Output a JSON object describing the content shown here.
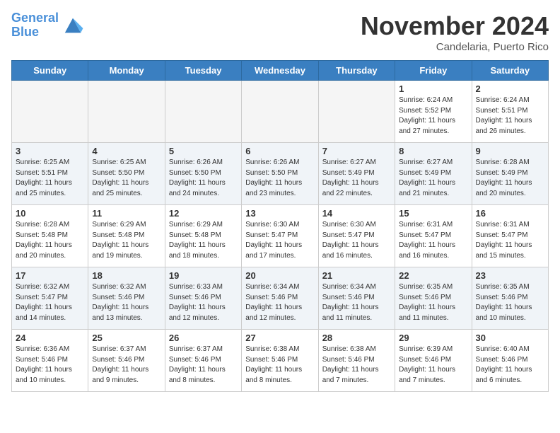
{
  "header": {
    "logo_line1": "General",
    "logo_line2": "Blue",
    "month": "November 2024",
    "location": "Candelaria, Puerto Rico"
  },
  "weekdays": [
    "Sunday",
    "Monday",
    "Tuesday",
    "Wednesday",
    "Thursday",
    "Friday",
    "Saturday"
  ],
  "weeks": [
    [
      {
        "day": "",
        "info": ""
      },
      {
        "day": "",
        "info": ""
      },
      {
        "day": "",
        "info": ""
      },
      {
        "day": "",
        "info": ""
      },
      {
        "day": "",
        "info": ""
      },
      {
        "day": "1",
        "info": "Sunrise: 6:24 AM\nSunset: 5:52 PM\nDaylight: 11 hours\nand 27 minutes."
      },
      {
        "day": "2",
        "info": "Sunrise: 6:24 AM\nSunset: 5:51 PM\nDaylight: 11 hours\nand 26 minutes."
      }
    ],
    [
      {
        "day": "3",
        "info": "Sunrise: 6:25 AM\nSunset: 5:51 PM\nDaylight: 11 hours\nand 25 minutes."
      },
      {
        "day": "4",
        "info": "Sunrise: 6:25 AM\nSunset: 5:50 PM\nDaylight: 11 hours\nand 25 minutes."
      },
      {
        "day": "5",
        "info": "Sunrise: 6:26 AM\nSunset: 5:50 PM\nDaylight: 11 hours\nand 24 minutes."
      },
      {
        "day": "6",
        "info": "Sunrise: 6:26 AM\nSunset: 5:50 PM\nDaylight: 11 hours\nand 23 minutes."
      },
      {
        "day": "7",
        "info": "Sunrise: 6:27 AM\nSunset: 5:49 PM\nDaylight: 11 hours\nand 22 minutes."
      },
      {
        "day": "8",
        "info": "Sunrise: 6:27 AM\nSunset: 5:49 PM\nDaylight: 11 hours\nand 21 minutes."
      },
      {
        "day": "9",
        "info": "Sunrise: 6:28 AM\nSunset: 5:49 PM\nDaylight: 11 hours\nand 20 minutes."
      }
    ],
    [
      {
        "day": "10",
        "info": "Sunrise: 6:28 AM\nSunset: 5:48 PM\nDaylight: 11 hours\nand 20 minutes."
      },
      {
        "day": "11",
        "info": "Sunrise: 6:29 AM\nSunset: 5:48 PM\nDaylight: 11 hours\nand 19 minutes."
      },
      {
        "day": "12",
        "info": "Sunrise: 6:29 AM\nSunset: 5:48 PM\nDaylight: 11 hours\nand 18 minutes."
      },
      {
        "day": "13",
        "info": "Sunrise: 6:30 AM\nSunset: 5:47 PM\nDaylight: 11 hours\nand 17 minutes."
      },
      {
        "day": "14",
        "info": "Sunrise: 6:30 AM\nSunset: 5:47 PM\nDaylight: 11 hours\nand 16 minutes."
      },
      {
        "day": "15",
        "info": "Sunrise: 6:31 AM\nSunset: 5:47 PM\nDaylight: 11 hours\nand 16 minutes."
      },
      {
        "day": "16",
        "info": "Sunrise: 6:31 AM\nSunset: 5:47 PM\nDaylight: 11 hours\nand 15 minutes."
      }
    ],
    [
      {
        "day": "17",
        "info": "Sunrise: 6:32 AM\nSunset: 5:47 PM\nDaylight: 11 hours\nand 14 minutes."
      },
      {
        "day": "18",
        "info": "Sunrise: 6:32 AM\nSunset: 5:46 PM\nDaylight: 11 hours\nand 13 minutes."
      },
      {
        "day": "19",
        "info": "Sunrise: 6:33 AM\nSunset: 5:46 PM\nDaylight: 11 hours\nand 12 minutes."
      },
      {
        "day": "20",
        "info": "Sunrise: 6:34 AM\nSunset: 5:46 PM\nDaylight: 11 hours\nand 12 minutes."
      },
      {
        "day": "21",
        "info": "Sunrise: 6:34 AM\nSunset: 5:46 PM\nDaylight: 11 hours\nand 11 minutes."
      },
      {
        "day": "22",
        "info": "Sunrise: 6:35 AM\nSunset: 5:46 PM\nDaylight: 11 hours\nand 11 minutes."
      },
      {
        "day": "23",
        "info": "Sunrise: 6:35 AM\nSunset: 5:46 PM\nDaylight: 11 hours\nand 10 minutes."
      }
    ],
    [
      {
        "day": "24",
        "info": "Sunrise: 6:36 AM\nSunset: 5:46 PM\nDaylight: 11 hours\nand 10 minutes."
      },
      {
        "day": "25",
        "info": "Sunrise: 6:37 AM\nSunset: 5:46 PM\nDaylight: 11 hours\nand 9 minutes."
      },
      {
        "day": "26",
        "info": "Sunrise: 6:37 AM\nSunset: 5:46 PM\nDaylight: 11 hours\nand 8 minutes."
      },
      {
        "day": "27",
        "info": "Sunrise: 6:38 AM\nSunset: 5:46 PM\nDaylight: 11 hours\nand 8 minutes."
      },
      {
        "day": "28",
        "info": "Sunrise: 6:38 AM\nSunset: 5:46 PM\nDaylight: 11 hours\nand 7 minutes."
      },
      {
        "day": "29",
        "info": "Sunrise: 6:39 AM\nSunset: 5:46 PM\nDaylight: 11 hours\nand 7 minutes."
      },
      {
        "day": "30",
        "info": "Sunrise: 6:40 AM\nSunset: 5:46 PM\nDaylight: 11 hours\nand 6 minutes."
      }
    ]
  ]
}
